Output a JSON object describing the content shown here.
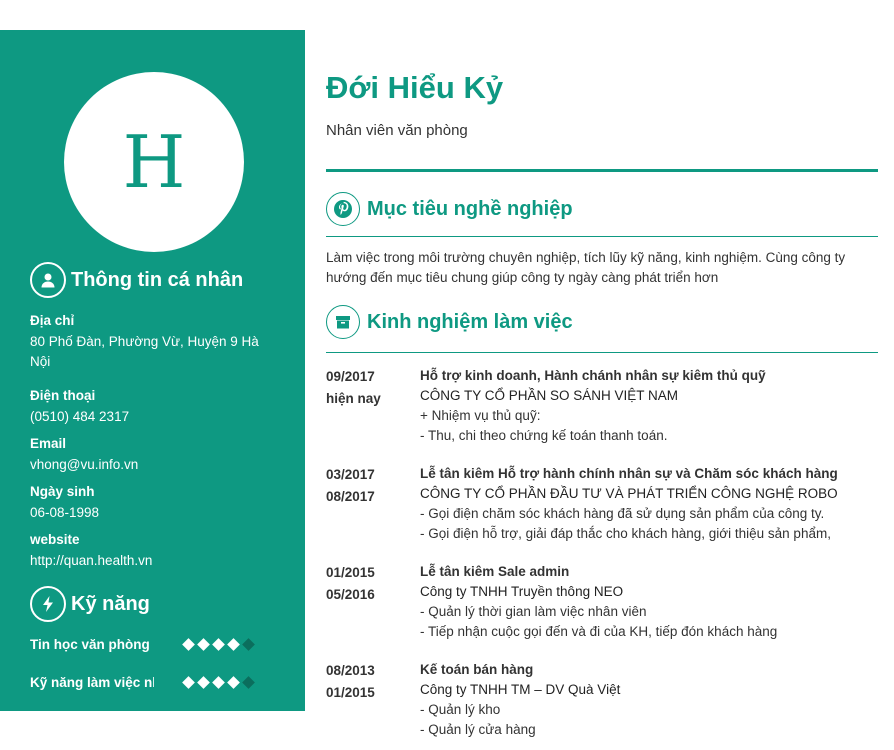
{
  "sidebar": {
    "avatar_letter": "H",
    "personal_heading": "Thông tin cá nhân",
    "address_label": "Địa chỉ",
    "address_value": "80 Phố Đàn, Phường Vừ, Huyện 9 Hà Nội",
    "phone_label": "Điện thoại",
    "phone_value": "(0510) 484 2317",
    "email_label": "Email",
    "email_value": "vhong@vu.info.vn",
    "birthday_label": "Ngày sinh",
    "birthday_value": "06-08-1998",
    "website_label": "website",
    "website_value": "http://quan.health.vn",
    "skills_heading": "Kỹ năng",
    "skills": [
      {
        "name": "Tin học văn phòng",
        "level": 4,
        "max": 5
      },
      {
        "name": "Kỹ năng làm việc nhóm",
        "level": 4,
        "max": 5
      }
    ],
    "colors": {
      "sidebar": "#0e9982",
      "dot_filled": "#ffffff",
      "dot_empty": "#0b6e5d"
    }
  },
  "main": {
    "name": "Đới Hiểu Kỷ",
    "job_title": "Nhân viên văn phòng",
    "objective_heading": "Mục tiêu nghề nghiệp",
    "objective_text": "Làm việc trong môi trường chuyên nghiệp, tích lũy kỹ năng, kinh nghiệm. Cùng công ty hướng đến mục tiêu chung giúp công ty ngày càng phát triển hơn",
    "experience_heading": "Kinh nghiệm làm việc",
    "experience": [
      {
        "start": "09/2017",
        "end": "hiện nay",
        "position": "Hỗ trợ kinh doanh, Hành chánh nhân sự kiêm thủ quỹ",
        "company": "CÔNG TY CỔ PHẦN SO SÁNH VIỆT NAM",
        "lines": [
          "+ Nhiệm vụ thủ quỹ:",
          "- Thu, chi theo chứng kế toán thanh toán."
        ]
      },
      {
        "start": "03/2017",
        "end": "08/2017",
        "position": "Lễ tân kiêm Hỗ trợ hành chính nhân sự và Chăm sóc khách hàng",
        "company": "CÔNG TY CỔ PHẦN ĐẦU TƯ VÀ PHÁT TRIỂN CÔNG NGHỆ ROBO",
        "lines": [
          "- Gọi điện chăm sóc khách hàng đã sử dụng sản phẩm của công ty.",
          "- Gọi điện hỗ trợ, giải đáp thắc cho khách hàng, giới thiệu sản phẩm,"
        ]
      },
      {
        "start": "01/2015",
        "end": "05/2016",
        "position": "Lễ tân kiêm Sale admin",
        "company": "Công ty TNHH Truyền thông NEO",
        "lines": [
          "- Quản lý thời gian làm việc nhân viên",
          "- Tiếp nhận cuộc gọi đến và đi của KH, tiếp đón khách hàng"
        ]
      },
      {
        "start": "08/2013",
        "end": "01/2015",
        "position": "Kế toán bán hàng",
        "company": "Công ty TNHH TM – DV Quà Việt",
        "lines": [
          "- Quản lý kho",
          "- Quản lý cửa hàng"
        ]
      }
    ]
  }
}
